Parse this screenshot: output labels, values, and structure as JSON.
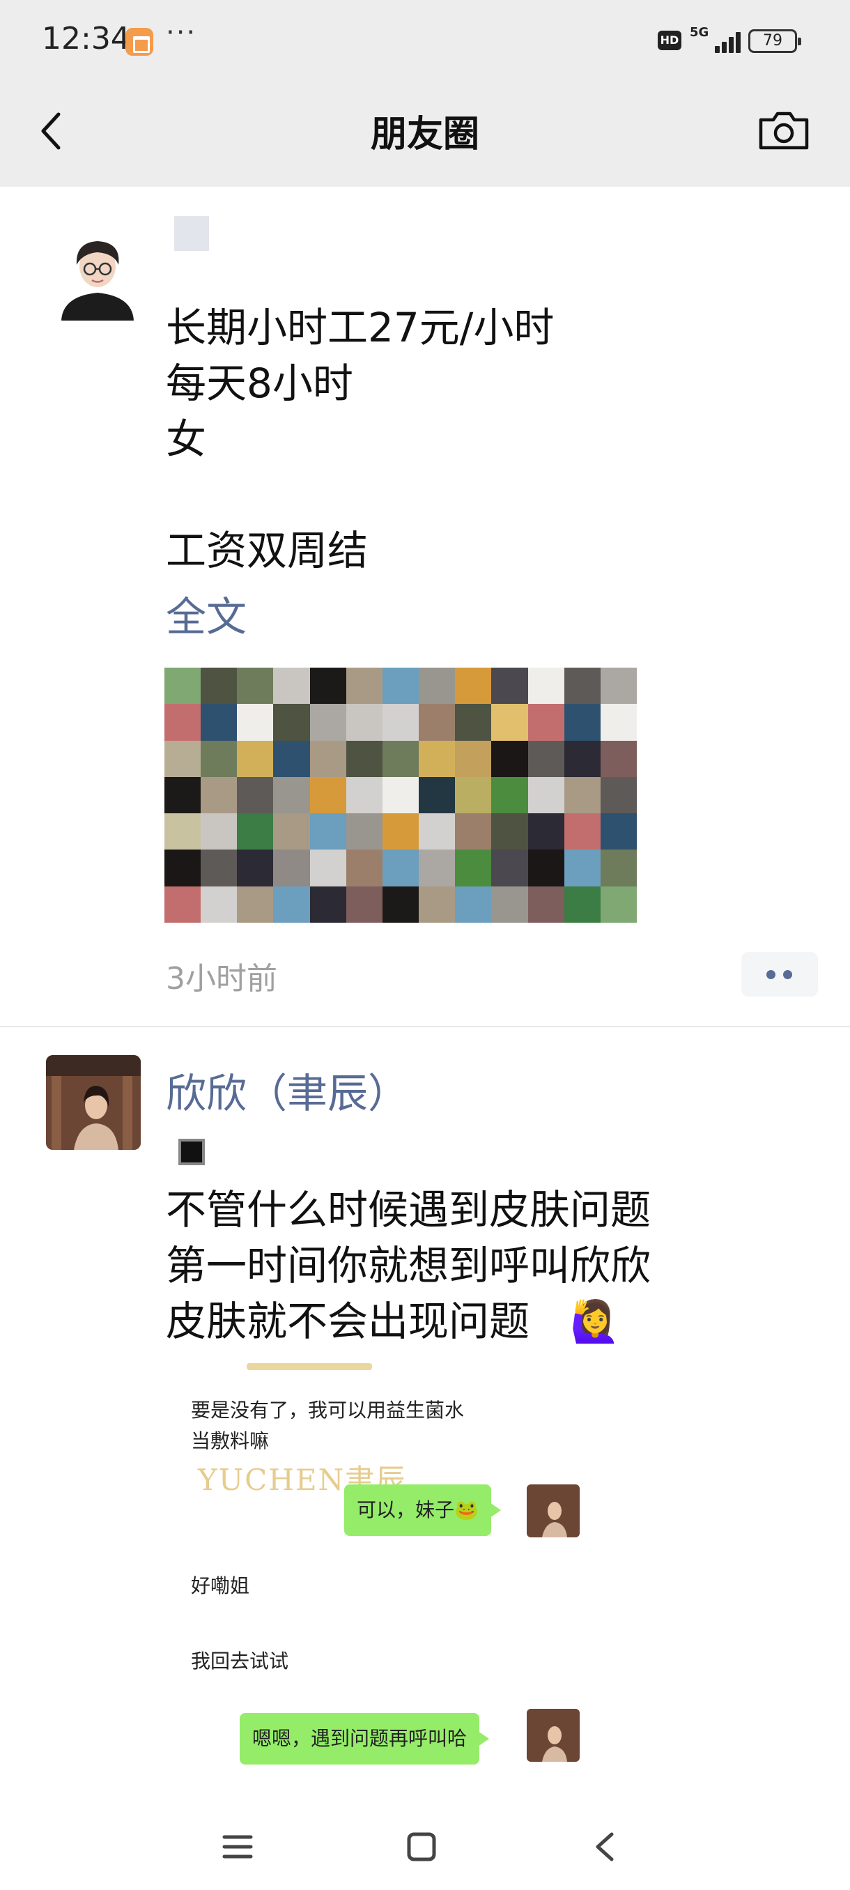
{
  "status_bar": {
    "time": "12:34",
    "overflow": "···",
    "hd_label": "HD",
    "network": "5G",
    "battery": "79"
  },
  "header": {
    "title": "朋友圈",
    "back_icon": "chevron-left-icon",
    "camera_icon": "camera-icon"
  },
  "posts": [
    {
      "name": "",
      "lines": "长期小时工27元/小时\n每天8小时\n女\n\n工资双周结",
      "full_text_link": "全文",
      "time": "3小时前",
      "image": "mosaic-blurred-photo"
    },
    {
      "name": "欣欣（聿辰）",
      "lines": "不管什么时候遇到皮肤问题\n第一时间你就想到呼叫欣欣\n皮肤就不会出现问题",
      "emoji": "🙋‍♀️",
      "chat_screenshot": {
        "msg1": "要是没有了，我可以用益生菌水\n当敷料嘛",
        "watermark": "YUCHEN聿辰",
        "reply1": "可以，妹子🐸",
        "msg2": "好嘞姐",
        "msg3": "我回去试试",
        "reply2": "嗯嗯，遇到问题再呼叫哈"
      }
    }
  ],
  "nav": {
    "menu_icon": "menu-icon",
    "home_icon": "home-square-icon",
    "back_icon": "back-triangle-icon"
  },
  "colors": {
    "link": "#576b95",
    "bubble": "#95ec69",
    "header_bg": "#ededed"
  }
}
